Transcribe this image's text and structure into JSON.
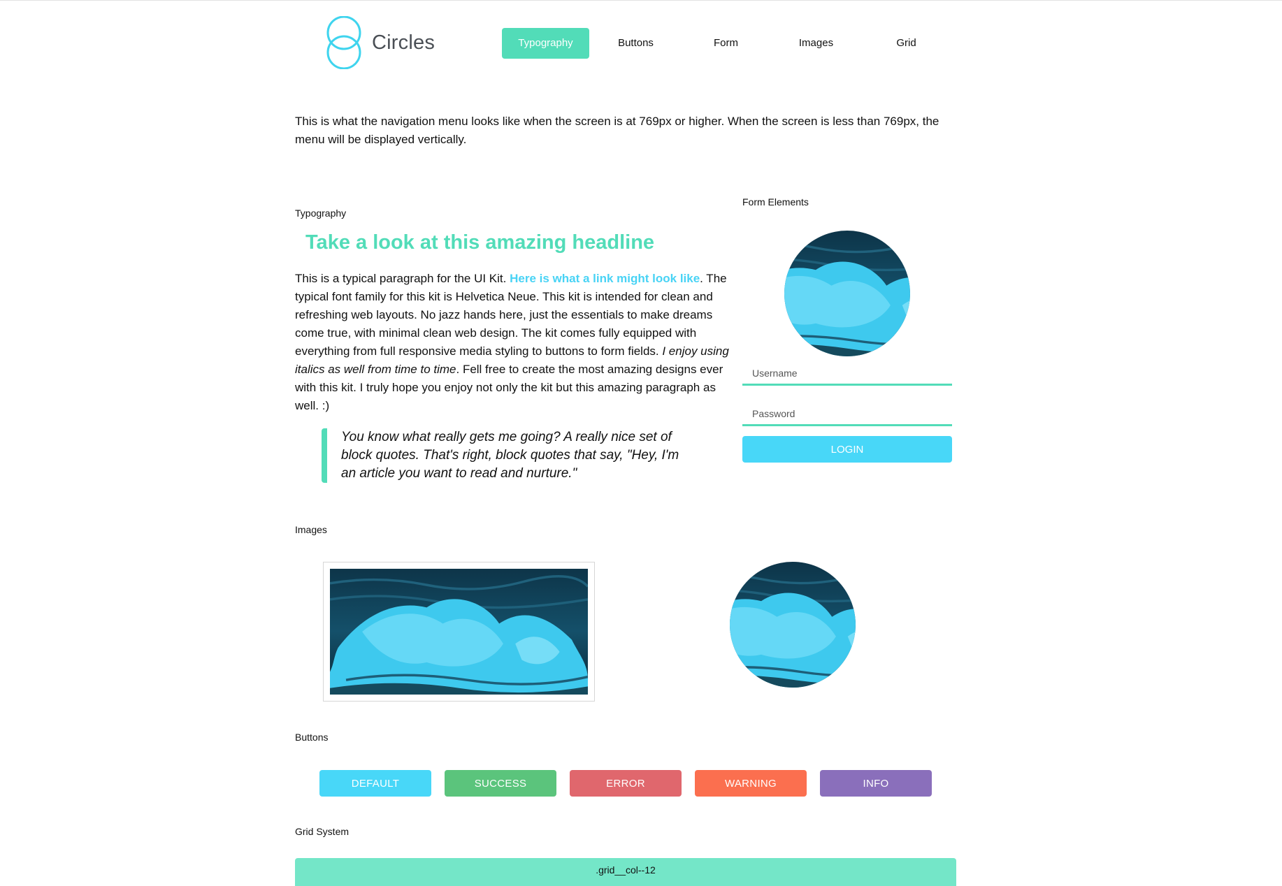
{
  "brand": {
    "name": "Circles",
    "accent": "#52dcb8",
    "info_blue": "#48d3f5"
  },
  "nav": {
    "items": [
      {
        "label": "Typography",
        "active": true
      },
      {
        "label": "Buttons",
        "active": false
      },
      {
        "label": "Form",
        "active": false
      },
      {
        "label": "Images",
        "active": false
      },
      {
        "label": "Grid",
        "active": false
      }
    ]
  },
  "intro": "This is what the navigation menu looks like when the screen is at 769px or higher. When the screen is less than 769px, the menu will be displayed vertically.",
  "typography": {
    "label": "Typography",
    "headline": "Take a look at this amazing headline",
    "para_start": "This is a typical paragraph for the UI Kit. ",
    "link_text": "Here is what a link might look like",
    "para_mid": ". The typical font family for this kit is Helvetica Neue. This kit is intended for clean and refreshing web layouts. No jazz hands here, just the essentials to make dreams come true, with minimal clean web design. The kit comes fully equipped with everything from full responsive media styling to buttons to form fields. ",
    "italic_text": "I enjoy using italics as well from time to time",
    "para_end": ". Fell free to create the most amazing designs ever with this kit. I truly hope you enjoy not only the kit but this amazing paragraph as well. :)",
    "quote": "You know what really gets me going? A really nice set of block quotes. That's right, block quotes that say, \"Hey, I'm an article you want to read and nurture.\""
  },
  "form": {
    "label": "Form Elements",
    "username_placeholder": "Username",
    "password_placeholder": "Password",
    "login_label": "LOGIN"
  },
  "images": {
    "label": "Images"
  },
  "buttons": {
    "label": "Buttons",
    "items": [
      {
        "label": "DEFAULT",
        "color": "#48d7f8"
      },
      {
        "label": "SUCCESS",
        "color": "#5bc47c"
      },
      {
        "label": "ERROR",
        "color": "#e0676d"
      },
      {
        "label": "WARNING",
        "color": "#fb6f4f"
      },
      {
        "label": "INFO",
        "color": "#8a6fbb"
      }
    ]
  },
  "grid": {
    "label": "Grid System",
    "col_label": ".grid__col--12"
  }
}
